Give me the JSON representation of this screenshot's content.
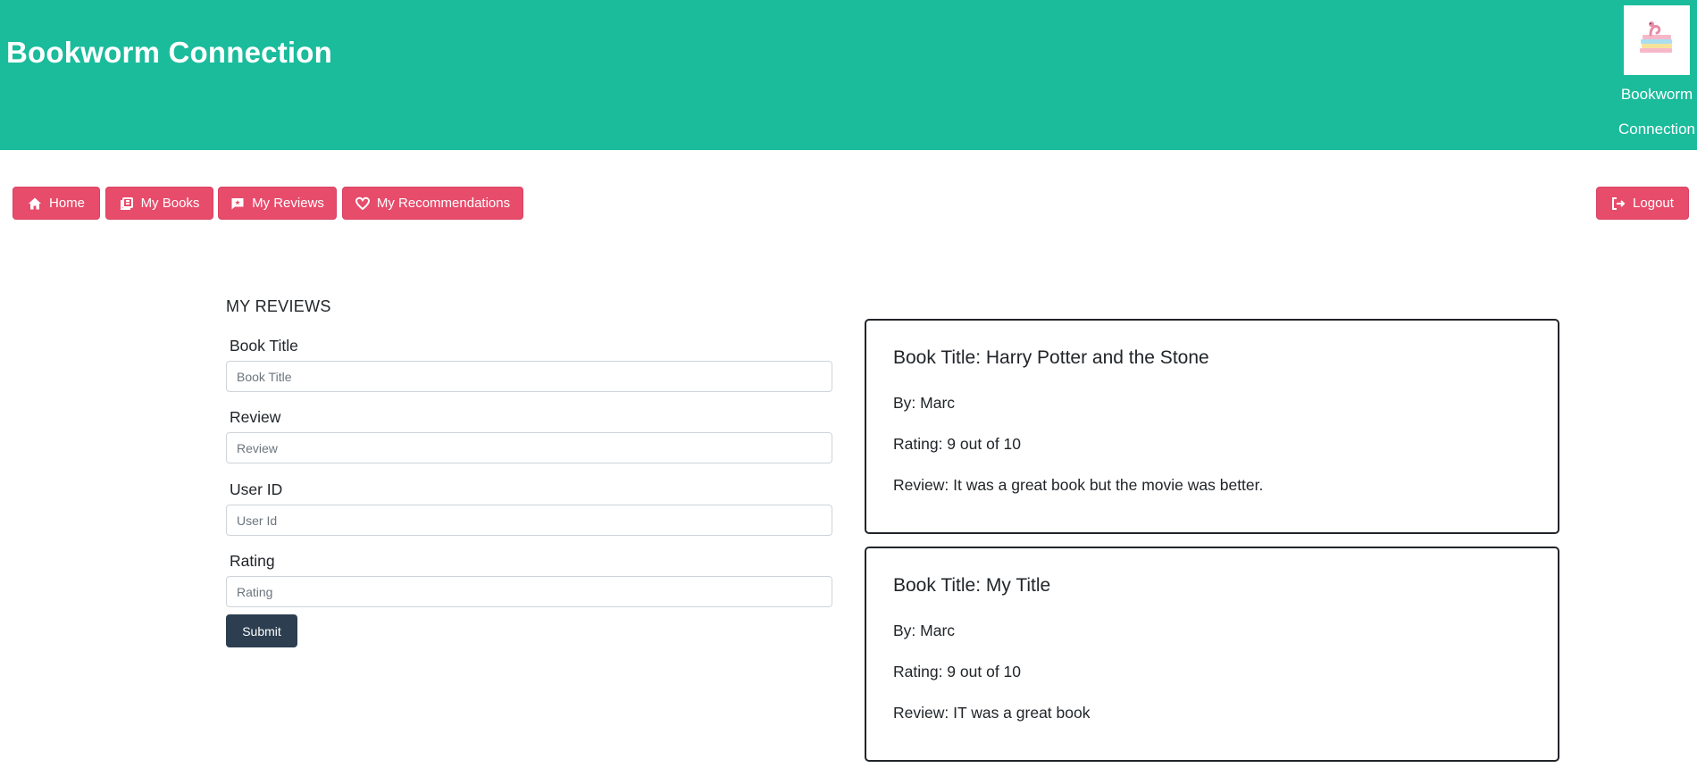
{
  "header": {
    "title": "Bookworm Connection",
    "logo_label_line1": "Bookworm",
    "logo_label_line2": "Connection"
  },
  "nav": {
    "home": "Home",
    "my_books": "My Books",
    "my_reviews": "My Reviews",
    "my_recommendations": "My Recommendations",
    "logout": "Logout"
  },
  "form": {
    "section_title": "MY REVIEWS",
    "book_title_label": "Book Title",
    "book_title_placeholder": "Book Title",
    "review_label": "Review",
    "review_placeholder": "Review",
    "user_id_label": "User ID",
    "user_id_placeholder": "User Id",
    "rating_label": "Rating",
    "rating_placeholder": "Rating",
    "submit_label": "Submit"
  },
  "reviews": [
    {
      "title": "Book Title: Harry Potter and the Stone",
      "by": "By: Marc",
      "rating": "Rating: 9 out of 10",
      "review": "Review: It was a great book but the movie was better."
    },
    {
      "title": "Book Title: My Title",
      "by": "By: Marc",
      "rating": "Rating: 9 out of 10",
      "review": "Review: IT was a great book"
    }
  ],
  "colors": {
    "header_bg": "#1abc9c",
    "nav_button": "#e74c6b",
    "submit_button": "#2c3e50"
  }
}
